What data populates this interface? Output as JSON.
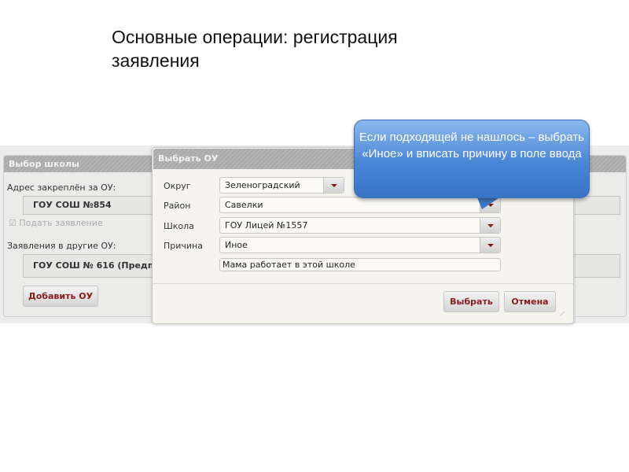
{
  "slide_title": "Основные операции: регистрация заявления",
  "background_panel": {
    "title": "Выбор школы",
    "address_label": "Адрес закреплён за ОУ:",
    "assigned_school": "ГОУ СОШ №854",
    "submit_checkbox_label": "Подать заявление",
    "other_label": "Заявления в другие ОУ:",
    "other_school": "ГОУ СОШ № 616 (Предпочи",
    "add_button": "Добавить ОУ"
  },
  "dialog": {
    "title": "Выбрать ОУ",
    "fields": [
      {
        "label": "Округ",
        "value": "Зеленоградский"
      },
      {
        "label": "Район",
        "value": "Савелки"
      },
      {
        "label": "Школа",
        "value": "ГОУ Лицей №1557"
      },
      {
        "label": "Причина",
        "value": "Иное"
      }
    ],
    "reason_text": "Мама работает в этой школе",
    "select_button": "Выбрать",
    "cancel_button": "Отмена"
  },
  "callout": {
    "text": "Если подходящей не нашлось – выбрать «Иное» и вписать причину в поле ввода"
  }
}
